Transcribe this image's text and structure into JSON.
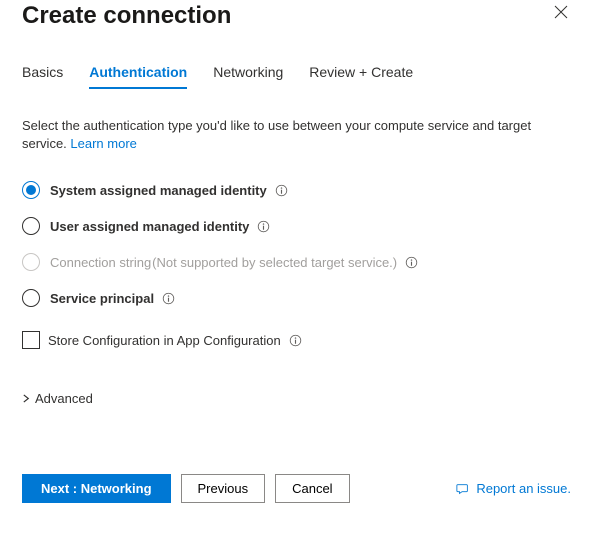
{
  "header": {
    "title": "Create connection"
  },
  "tabs": [
    {
      "label": "Basics",
      "active": false
    },
    {
      "label": "Authentication",
      "active": true
    },
    {
      "label": "Networking",
      "active": false
    },
    {
      "label": "Review + Create",
      "active": false
    }
  ],
  "description": {
    "text": "Select the authentication type you'd like to use between your compute service and target service. ",
    "link_label": "Learn more"
  },
  "auth_options": [
    {
      "label": "System assigned managed identity",
      "note": "",
      "selected": true,
      "disabled": false
    },
    {
      "label": "User assigned managed identity",
      "note": "",
      "selected": false,
      "disabled": false
    },
    {
      "label": "Connection string",
      "note": "(Not supported by selected target service.)",
      "selected": false,
      "disabled": true
    },
    {
      "label": "Service principal",
      "note": "",
      "selected": false,
      "disabled": false
    }
  ],
  "store_checkbox": {
    "label": "Store Configuration in App Configuration",
    "checked": false
  },
  "advanced": {
    "label": "Advanced"
  },
  "footer": {
    "next_label": "Next : Networking",
    "previous_label": "Previous",
    "cancel_label": "Cancel",
    "report_label": "Report an issue."
  }
}
